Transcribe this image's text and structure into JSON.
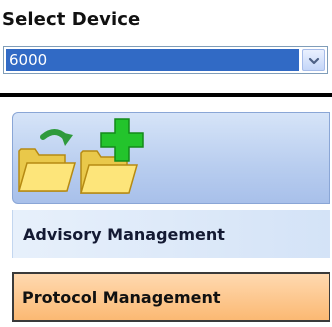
{
  "header": {
    "title": "Select Device"
  },
  "device_select": {
    "value": "6000",
    "button_icon": "chevron-down-icon"
  },
  "toolbar": {
    "icons": [
      "folder-refresh-icon",
      "folder-add-icon"
    ]
  },
  "nav": {
    "items": [
      {
        "label": "Advisory Management",
        "selected": false
      },
      {
        "label": "Protocol Management",
        "selected": true
      }
    ]
  },
  "colors": {
    "selection": "#316ac5",
    "selected_item": "#fbb973",
    "panel": "#b8cdef",
    "arrow_green": "#2f9a3c",
    "plus_green": "#23c42c",
    "folder_yellow": "#fde57a"
  }
}
